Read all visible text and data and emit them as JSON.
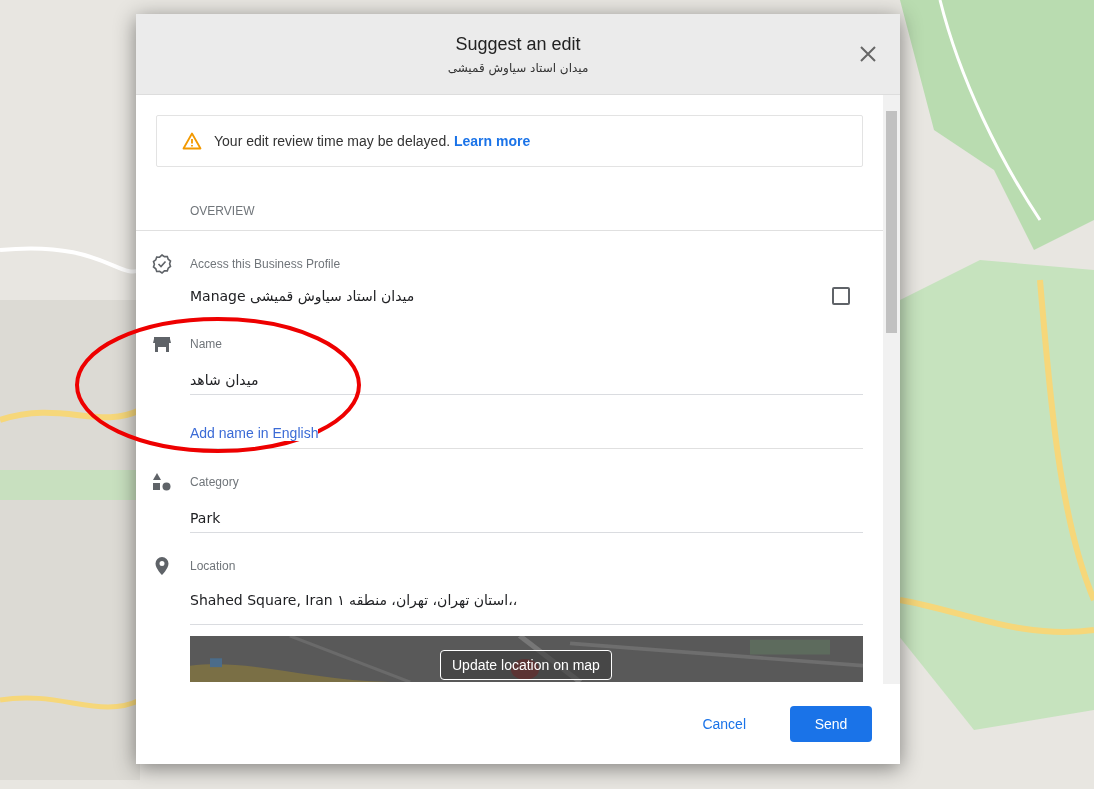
{
  "dialog": {
    "title": "Suggest an edit",
    "subtitle": "میدان استاد سیاوش قمیشی"
  },
  "notice": {
    "text": "Your edit review time may be delayed.",
    "link": "Learn more"
  },
  "section": "OVERVIEW",
  "fields": [
    {
      "kind": "checkbox",
      "label": "Access this Business Profile",
      "value": "Manage میدان استاد سیاوش قمیشی",
      "checked": false
    },
    {
      "kind": "text",
      "label": "Name",
      "value": "میدان شاهد",
      "link": "Add name in English"
    },
    {
      "kind": "text",
      "label": "Category",
      "value": "Park"
    },
    {
      "kind": "location",
      "label": "Location",
      "value": "Shahed Square, Iran استان تهران، تهران، منطقه ۱،،",
      "map_button": "Update location on map"
    }
  ],
  "buttons": [
    {
      "kind": "text",
      "label": "Cancel"
    },
    {
      "kind": "primary",
      "label": "Send"
    }
  ]
}
